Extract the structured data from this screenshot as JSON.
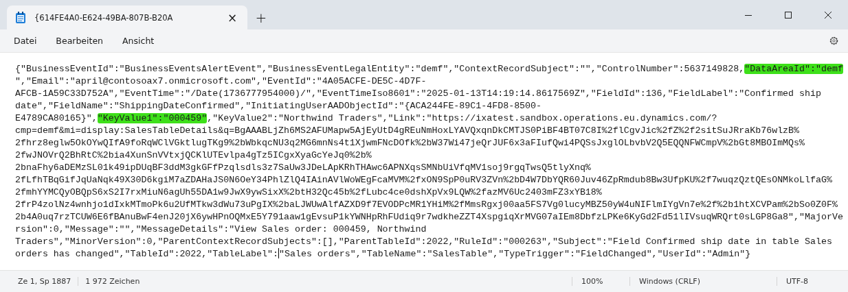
{
  "window": {
    "tab_title": "{614FE4A0-E624-49BA-807B-B20A",
    "close_tab": "×",
    "new_tab": "+"
  },
  "menu": [
    {
      "label": "Datei"
    },
    {
      "label": "Bearbeiten"
    },
    {
      "label": "Ansicht"
    }
  ],
  "editor": {
    "lines": [
      [
        {
          "text": "{\"BusinessEventId\":\"BusinessEventsAlertEvent\",\"BusinessEventLegalEntity\":\"demf\",\"ContextRecordSubject\":\"\",\"ControlNumber\":5637149828,",
          "kind": "text"
        },
        {
          "text": "\"DataAreaId\":\"demf",
          "kind": "highlight"
        }
      ],
      [
        {
          "text": "\",\"Email\":\"april@contosoax7.onmicrosoft.com\",\"EventId\":\"4A05ACFE-DE5C-4D7F-",
          "kind": "text"
        }
      ],
      [
        {
          "text": "AFCB-1A59C33D752A\",\"EventTime\":\"/Date(1736777954000)/\",\"EventTimeIso8601\":\"2025-01-13T14:19:14.8617569Z\",\"FieldId\":136,\"FieldLabel\":\"Confirmed ship",
          "kind": "text"
        }
      ],
      [
        {
          "text": "date\",\"FieldName\":\"ShippingDateConfirmed\",\"InitiatingUserAADObjectId\":\"{ACA244FE-89C1-4FD8-8500-",
          "kind": "text"
        }
      ],
      [
        {
          "text": "E4789CA80165}\",",
          "kind": "text"
        },
        {
          "text": "\"KeyValue1\":\"000459\"",
          "kind": "highlight"
        },
        {
          "text": ",\"KeyValue2\":\"Northwind Traders\",\"Link\":\"https://ixatest.sandbox.operations.eu.dynamics.com/?",
          "kind": "text"
        }
      ],
      [
        {
          "text": "cmp=demf&mi=display:SalesTableDetails&q=BgAAABLjZh6MS2AFUMapw5AjEyUtD4gREuNmHoxLYAVQxqnDkCMTJS0PiBF4BT07C8I%2flCgvJic%2fZ%2f2sitSuJRraKb76wlzB%",
          "kind": "text"
        }
      ],
      [
        {
          "text": "2fhrz8eglw5OkOYwQIfA9foRqWClVGktlugTKg9%2bWbkqcNU3q2MG6mnNs4t1XjwmFNcDOfk%2bW37Wi47jeQrJUF6x3aFIufQwi4PQSsJxglOLbvbV2Q5EQQNFWCmpV%2bGt8MBOImMQs%",
          "kind": "text"
        }
      ],
      [
        {
          "text": "2fwJNOVrQ2BhRtC%2bia4XunSnVVtxjQCKlUTEvlpa4gTz5ICgxXyaGcYeJq0%2b%",
          "kind": "text"
        }
      ],
      [
        {
          "text": "2bnaFhy6aDEMzSL01k49ipDUqBF3ddM3gkGFfPzqlsdls3z7SaUw3JDeLApKRhTHAwc6APNXqsSMNbUiVfqMV1soj9rgqTwsQ5tlyXnq%",
          "kind": "text"
        }
      ],
      [
        {
          "text": "2fLfhTBqGifJqUaNqk49X30D6kgiM7aZDAHaJS0N6OeY34PhlZlQ4IAinAVlWoWEgFcaMVM%2fxON9SpP0uRV3ZVn%2bD4W7DbYQR60Juv46ZpRmdub8Bw3UfpKU%2f7wuqzQztQEsONMkoLlfaG%",
          "kind": "text"
        }
      ],
      [
        {
          "text": "2fmhYYMCQyOBQpS6xS2I7rxMiuN6agUh55DA1w9JwX9ywSixX%2btH32Qc45b%2fLubc4ce0dshXpVx9LQW%2fazMV6Uc2403mFZ3xYB18%",
          "kind": "text"
        }
      ],
      [
        {
          "text": "2frP4zolNz4wnhjo1dIxkMTmoPk6u2UfMTkw3dWu73uPgIX%2baLJWUwAlfAZXD9f7EVODPcMR1YHiM%2fMmsRgxj00aa5FS7Vg0lucyMBZ50yW4uNIFlmIYgVn7e%2f%2b1htXCVPam%2bSo0Z0F%",
          "kind": "text"
        }
      ],
      [
        {
          "text": "2b4A0uq7rzTCUW6E6fBAnuBwF4enJ20jX6ywHPnOQMxE5Y791aaw1gEvsuP1kYWNHpRhFUdiq9r7wdkheZZT4XspgiqXrMVG07aIEm8DbfzLPKe6KyGd2Fd51lIVsuqWRQrt0sLGP8Ga8\",\"MajorVe",
          "kind": "text"
        }
      ],
      [
        {
          "text": "rsion\":0,\"Message\":\"\",\"MessageDetails\":\"View Sales order: 000459, Northwind",
          "kind": "text"
        }
      ],
      [
        {
          "text": "Traders\",\"MinorVersion\":0,\"ParentContextRecordSubjects\":[],\"ParentTableId\":2022,\"RuleId\":\"000263\",\"Subject\":\"Field Confirmed ship date in table Sales",
          "kind": "text"
        }
      ],
      [
        {
          "text": "orders has changed\",\"TableId\":2022,\"TableLabel\":",
          "kind": "text"
        },
        {
          "kind": "caret"
        },
        {
          "text": "\"Sales orders\",\"TableName\":\"SalesTable\",\"TypeTrigger\":\"FieldChanged\",\"UserId\":\"Admin\"}",
          "kind": "text"
        }
      ]
    ]
  },
  "status_bar": {
    "position": "Ze 1, Sp 1887",
    "characters": "1 972 Zeichen",
    "zoom": "100%",
    "line_endings": "Windows (CRLF)",
    "encoding": "UTF-8"
  }
}
